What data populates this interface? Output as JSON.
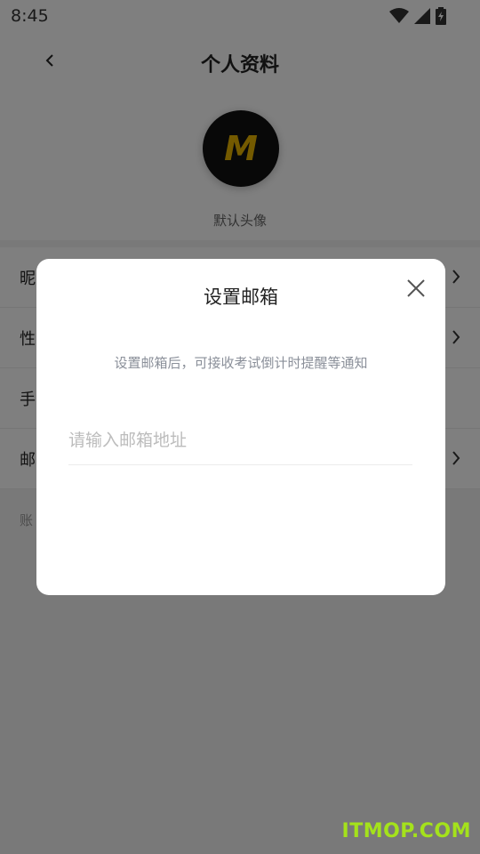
{
  "status_bar": {
    "time": "8:45",
    "icons": [
      "wifi-icon",
      "signal-icon",
      "battery-icon"
    ]
  },
  "header": {
    "title": "个人资料",
    "back_icon": "chevron-left-icon"
  },
  "avatar": {
    "letter": "M",
    "caption": "默认头像",
    "letter_color": "#e8b400",
    "bg_color": "#111111"
  },
  "list": {
    "rows": [
      {
        "label": "昵",
        "has_chevron": true
      },
      {
        "label": "性",
        "has_chevron": true
      },
      {
        "label": "手",
        "has_chevron": false
      },
      {
        "label": "邮",
        "has_chevron": true
      }
    ],
    "footer_note": "账"
  },
  "dialog": {
    "title": "设置邮箱",
    "close_icon": "close-icon",
    "description": "设置邮箱后，可接收考试倒计时提醒等通知",
    "email_input": {
      "value": "",
      "placeholder": "请输入邮箱地址"
    }
  },
  "watermark": "ITMOP.COM",
  "colors": {
    "overlay": "rgba(0,0,0,0.5)",
    "watermark": "#a4e21b"
  }
}
